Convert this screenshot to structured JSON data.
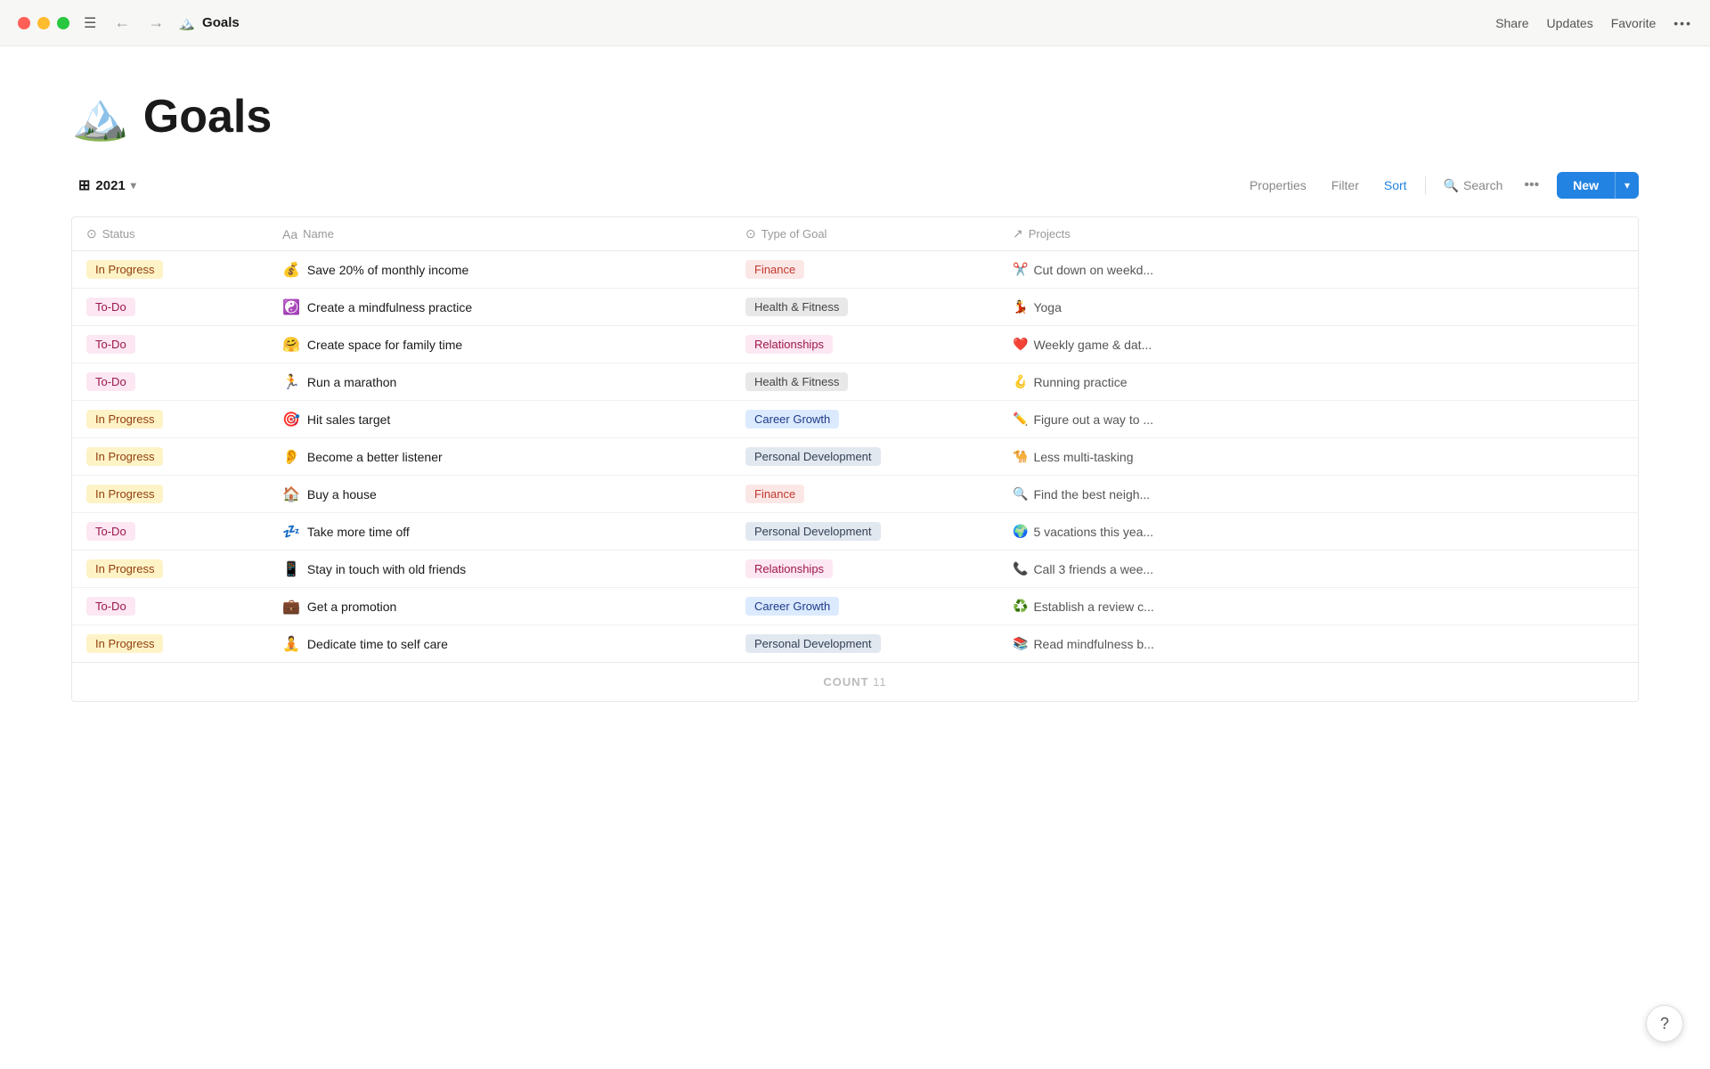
{
  "titlebar": {
    "page_title": "Goals",
    "page_emoji": "🏔️",
    "share_label": "Share",
    "updates_label": "Updates",
    "favorite_label": "Favorite"
  },
  "toolbar": {
    "view_name": "2021",
    "properties_label": "Properties",
    "filter_label": "Filter",
    "sort_label": "Sort",
    "search_label": "Search",
    "new_label": "New"
  },
  "table": {
    "columns": [
      {
        "id": "status",
        "icon": "⊙",
        "label": "Status"
      },
      {
        "id": "name",
        "icon": "Aa",
        "label": "Name"
      },
      {
        "id": "goal_type",
        "icon": "⊙",
        "label": "Type of Goal"
      },
      {
        "id": "projects",
        "icon": "↗",
        "label": "Projects"
      }
    ],
    "rows": [
      {
        "status": "In Progress",
        "status_class": "status-in-progress",
        "emoji": "💰",
        "name": "Save 20% of monthly income",
        "goal_type": "Finance",
        "goal_class": "gt-finance",
        "project_emoji": "✂️",
        "project": "Cut down on weekd..."
      },
      {
        "status": "To-Do",
        "status_class": "status-todo",
        "emoji": "☯️",
        "name": "Create a mindfulness practice",
        "goal_type": "Health & Fitness",
        "goal_class": "gt-health",
        "project_emoji": "💃",
        "project": "Yoga"
      },
      {
        "status": "To-Do",
        "status_class": "status-todo",
        "emoji": "🤗",
        "name": "Create space for family time",
        "goal_type": "Relationships",
        "goal_class": "gt-relationships",
        "project_emoji": "❤️",
        "project": "Weekly game & dat..."
      },
      {
        "status": "To-Do",
        "status_class": "status-todo",
        "emoji": "🏃",
        "name": "Run a marathon",
        "goal_type": "Health & Fitness",
        "goal_class": "gt-health",
        "project_emoji": "🪝",
        "project": "Running practice"
      },
      {
        "status": "In Progress",
        "status_class": "status-in-progress",
        "emoji": "🎯",
        "name": "Hit sales target",
        "goal_type": "Career Growth",
        "goal_class": "gt-career",
        "project_emoji": "✏️",
        "project": "Figure out a way to ..."
      },
      {
        "status": "In Progress",
        "status_class": "status-in-progress",
        "emoji": "👂",
        "name": "Become a better listener",
        "goal_type": "Personal Development",
        "goal_class": "gt-personal",
        "project_emoji": "🐪",
        "project": "Less multi-tasking"
      },
      {
        "status": "In Progress",
        "status_class": "status-in-progress",
        "emoji": "🏠",
        "name": "Buy a house",
        "goal_type": "Finance",
        "goal_class": "gt-finance",
        "project_emoji": "🔍",
        "project": "Find the best neigh..."
      },
      {
        "status": "To-Do",
        "status_class": "status-todo",
        "emoji": "💤",
        "name": "Take more time off",
        "goal_type": "Personal Development",
        "goal_class": "gt-personal",
        "project_emoji": "🌍",
        "project": "5 vacations this yea..."
      },
      {
        "status": "In Progress",
        "status_class": "status-in-progress",
        "emoji": "📱",
        "name": "Stay in touch with old friends",
        "goal_type": "Relationships",
        "goal_class": "gt-relationships",
        "project_emoji": "📞",
        "project": "Call 3 friends a wee..."
      },
      {
        "status": "To-Do",
        "status_class": "status-todo",
        "emoji": "💼",
        "name": "Get a promotion",
        "goal_type": "Career Growth",
        "goal_class": "gt-career",
        "project_emoji": "♻️",
        "project": "Establish a review c..."
      },
      {
        "status": "In Progress",
        "status_class": "status-in-progress",
        "emoji": "🧘",
        "name": "Dedicate time to self care",
        "goal_type": "Personal Development",
        "goal_class": "gt-personal",
        "project_emoji": "📚",
        "project": "Read mindfulness b..."
      }
    ]
  },
  "footer": {
    "count_label": "COUNT",
    "count_value": "11"
  },
  "help_label": "?"
}
